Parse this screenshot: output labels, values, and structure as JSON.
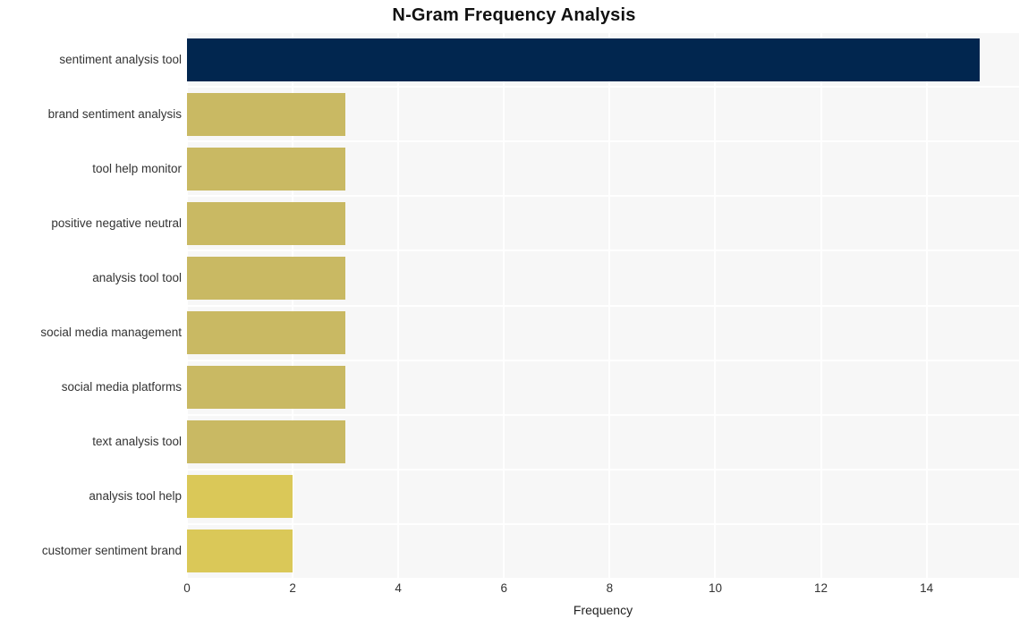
{
  "chart_data": {
    "type": "bar",
    "orientation": "horizontal",
    "title": "N-Gram Frequency Analysis",
    "xlabel": "Frequency",
    "ylabel": "",
    "xlim": [
      0,
      15.75
    ],
    "xticks": [
      0,
      2,
      4,
      6,
      8,
      10,
      12,
      14
    ],
    "xtick_labels": [
      "0",
      "2",
      "4",
      "6",
      "8",
      "10",
      "12",
      "14"
    ],
    "grid": true,
    "legend": null,
    "categories": [
      "sentiment analysis tool",
      "brand sentiment analysis",
      "tool help monitor",
      "positive negative neutral",
      "analysis tool tool",
      "social media management",
      "social media platforms",
      "text analysis tool",
      "analysis tool help",
      "customer sentiment brand"
    ],
    "values": [
      15,
      3,
      3,
      3,
      3,
      3,
      3,
      3,
      2,
      2
    ],
    "bar_colors": [
      "#01264f",
      "#c9b963",
      "#c9b963",
      "#c9b963",
      "#c9b963",
      "#c9b963",
      "#c9b963",
      "#c9b963",
      "#dac858",
      "#dac858"
    ],
    "plot_background": "#f7f7f7",
    "gridline_color": "#ffffff",
    "figure_background": "#ffffff",
    "text_color": "#333333"
  }
}
